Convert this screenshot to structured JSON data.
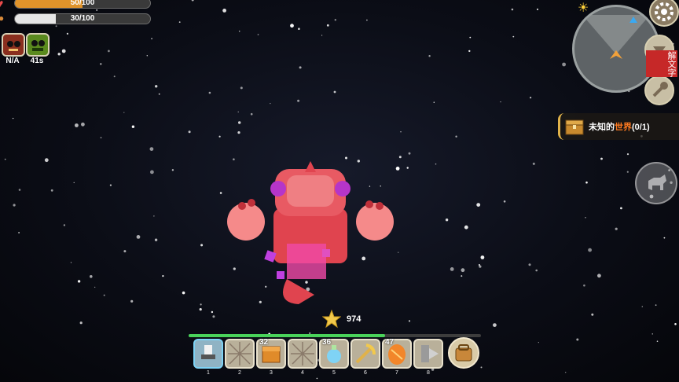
{
  "status": {
    "health_text": "50/100",
    "health_level": 0.5,
    "hunger_text": "30/100",
    "hunger_level": 0.3
  },
  "buffs": [
    {
      "icon": "red-monster-face-icon",
      "label": "N/A"
    },
    {
      "icon": "green-monster-face-icon",
      "label": "41s"
    }
  ],
  "quest": {
    "prefix": "未知的",
    "highlight": "世界",
    "progress": "(0/1)"
  },
  "star_count": "974",
  "watermark": "解文字",
  "hotbar": {
    "slots": [
      {
        "number": "1",
        "count": "",
        "icon": "robot-wand-icon",
        "selected": true
      },
      {
        "number": "2",
        "count": "",
        "icon": "web-tile-icon",
        "selected": false
      },
      {
        "number": "3",
        "count": "32",
        "icon": "orange-box-icon",
        "selected": false
      },
      {
        "number": "4",
        "count": "",
        "icon": "web-tile-icon",
        "selected": false
      },
      {
        "number": "5",
        "count": "36",
        "icon": "potion-bottle-icon",
        "selected": false
      },
      {
        "number": "6",
        "count": "",
        "icon": "golden-pickaxe-icon",
        "selected": false
      },
      {
        "number": "7",
        "count": "47",
        "icon": "orange-egg-icon",
        "selected": false
      },
      {
        "number": "8",
        "count": "",
        "icon": "drill-icon",
        "selected": false
      }
    ]
  },
  "colors": {
    "health": "#e0932a",
    "hunger": "#e6e6e6",
    "quest_highlight": "#ff7a20",
    "boss": "#e0444f"
  }
}
